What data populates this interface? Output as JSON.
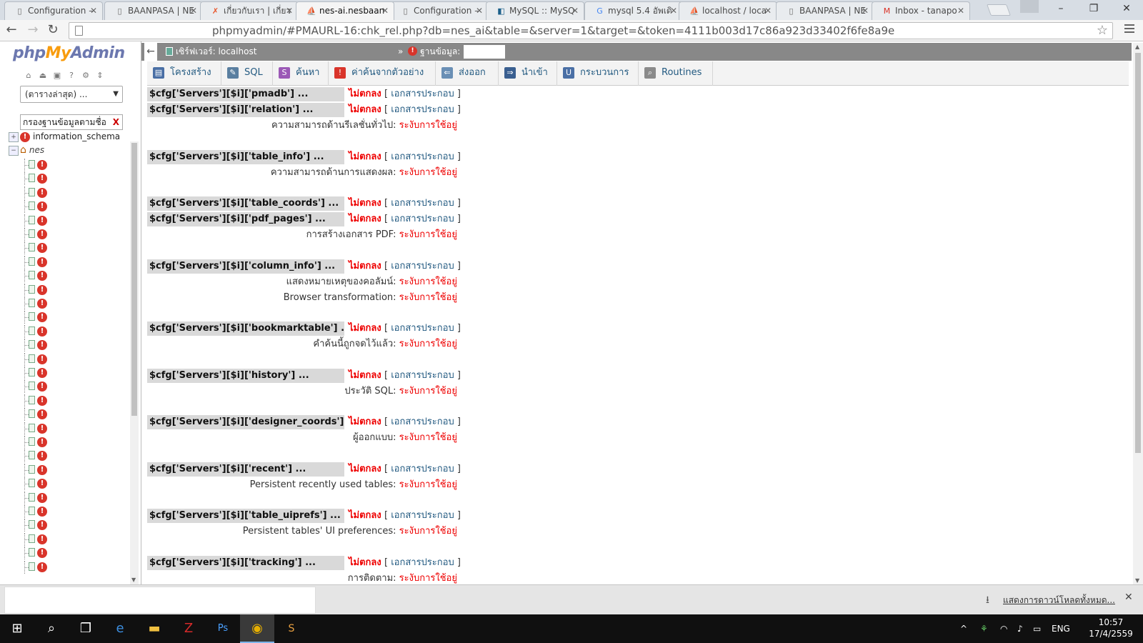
{
  "browser": {
    "tabs": [
      {
        "title": "Configuration – ",
        "icon": "page-icon"
      },
      {
        "title": "BAANPASA | NE",
        "icon": "page-icon"
      },
      {
        "title": "เกี่ยวกับเรา | เกี่ยว",
        "icon": "x-brand-icon"
      },
      {
        "title": "nes-ai.nesbaan",
        "icon": "pma-icon"
      },
      {
        "title": "Configuration – ",
        "icon": "page-icon"
      },
      {
        "title": "MySQL :: MySQ",
        "icon": "mysql-icon"
      },
      {
        "title": "mysql 5.4 อัพเดิ",
        "icon": "google-icon"
      },
      {
        "title": "localhost / loca",
        "icon": "pma-icon"
      },
      {
        "title": "BAANPASA | NE",
        "icon": "page-icon"
      },
      {
        "title": "Inbox - tanapo",
        "icon": "gmail-icon"
      }
    ],
    "url": "phpmyadmin/#PMAURL-16:chk_rel.php?db=nes_ai&table=&server=1&target=&token=4111b003d17c86a923d33402f6fe8a9e"
  },
  "nav": {
    "logo_php": "php",
    "logo_my": "My",
    "logo_admin": "Admin",
    "recent_select": "(ตารางล่าสุด) ...",
    "filter_value": "กรองฐานข้อมูลตามชื่อ",
    "filter_clear": "X",
    "databases": [
      {
        "name": "information_schema",
        "italic": false
      },
      {
        "name": "nes",
        "italic": true
      }
    ],
    "table_count": 30
  },
  "breadcrumb": {
    "server_label": "เซิร์ฟเวอร์: localhost",
    "sep": "»",
    "db_label": "ฐานข้อมูล:"
  },
  "menu_tabs": [
    {
      "label": "โครงสร้าง",
      "icon": "structure-icon",
      "color": "#4a6fa5"
    },
    {
      "label": "SQL",
      "icon": "sql-icon",
      "color": "#5a7fa0"
    },
    {
      "label": "ค้นหา",
      "icon": "search-icon",
      "color": "#9b59b6"
    },
    {
      "label": "ค่าค้นจากตัวอย่าง",
      "icon": "query-icon",
      "color": "#d9342a"
    },
    {
      "label": "ส่งออก",
      "icon": "export-icon",
      "color": "#6a8fb5"
    },
    {
      "label": "นำเข้า",
      "icon": "import-icon",
      "color": "#3a5f90"
    },
    {
      "label": "กระบวนการ",
      "icon": "operations-icon",
      "color": "#4a6fa5"
    },
    {
      "label": "Routines",
      "icon": "routines-icon",
      "color": "#8a8a8a"
    }
  ],
  "status_text": "ไม่ตกลง",
  "doc_open": "[",
  "doc_label": "เอกสารประกอบ",
  "doc_close": "]",
  "disabled_text": "ระงับการใช้อยู่",
  "params": [
    {
      "name": "$cfg['Servers'][$i]['pmadb'] ...",
      "features": []
    },
    {
      "name": "$cfg['Servers'][$i]['relation'] ...",
      "features": [
        "ความสามารถด้านรีเลชั่นทั่วไป:"
      ]
    },
    {
      "name": "$cfg['Servers'][$i]['table_info'] ...",
      "features": [
        "ความสามารถด้านการแสดงผล:"
      ]
    },
    {
      "name": "$cfg['Servers'][$i]['table_coords'] ...",
      "features": []
    },
    {
      "name": "$cfg['Servers'][$i]['pdf_pages'] ...",
      "features": [
        "การสร้างเอกสาร PDF:"
      ]
    },
    {
      "name": "$cfg['Servers'][$i]['column_info'] ...",
      "features": [
        "แสดงหมายเหตุของคอลัมน์:",
        "Browser transformation:"
      ]
    },
    {
      "name": "$cfg['Servers'][$i]['bookmarktable'] ...",
      "features": [
        "คำค้นนี้ถูกจดไว้แล้ว:"
      ]
    },
    {
      "name": "$cfg['Servers'][$i]['history'] ...",
      "features": [
        "ประวัติ SQL:"
      ]
    },
    {
      "name": "$cfg['Servers'][$i]['designer_coords'] ...",
      "features": [
        "ผู้ออกแบบ:"
      ]
    },
    {
      "name": "$cfg['Servers'][$i]['recent'] ...",
      "features": [
        "Persistent recently used tables:"
      ]
    },
    {
      "name": "$cfg['Servers'][$i]['table_uiprefs'] ...",
      "features": [
        "Persistent tables' UI preferences:"
      ]
    },
    {
      "name": "$cfg['Servers'][$i]['tracking'] ...",
      "features": [
        "การติดตาม:"
      ]
    }
  ],
  "download_shelf": {
    "show_all": "แสดงการดาวน์โหลดทั้งหมด..."
  },
  "taskbar": {
    "lang": "ENG",
    "time": "10:57",
    "date": "17/4/2559"
  }
}
